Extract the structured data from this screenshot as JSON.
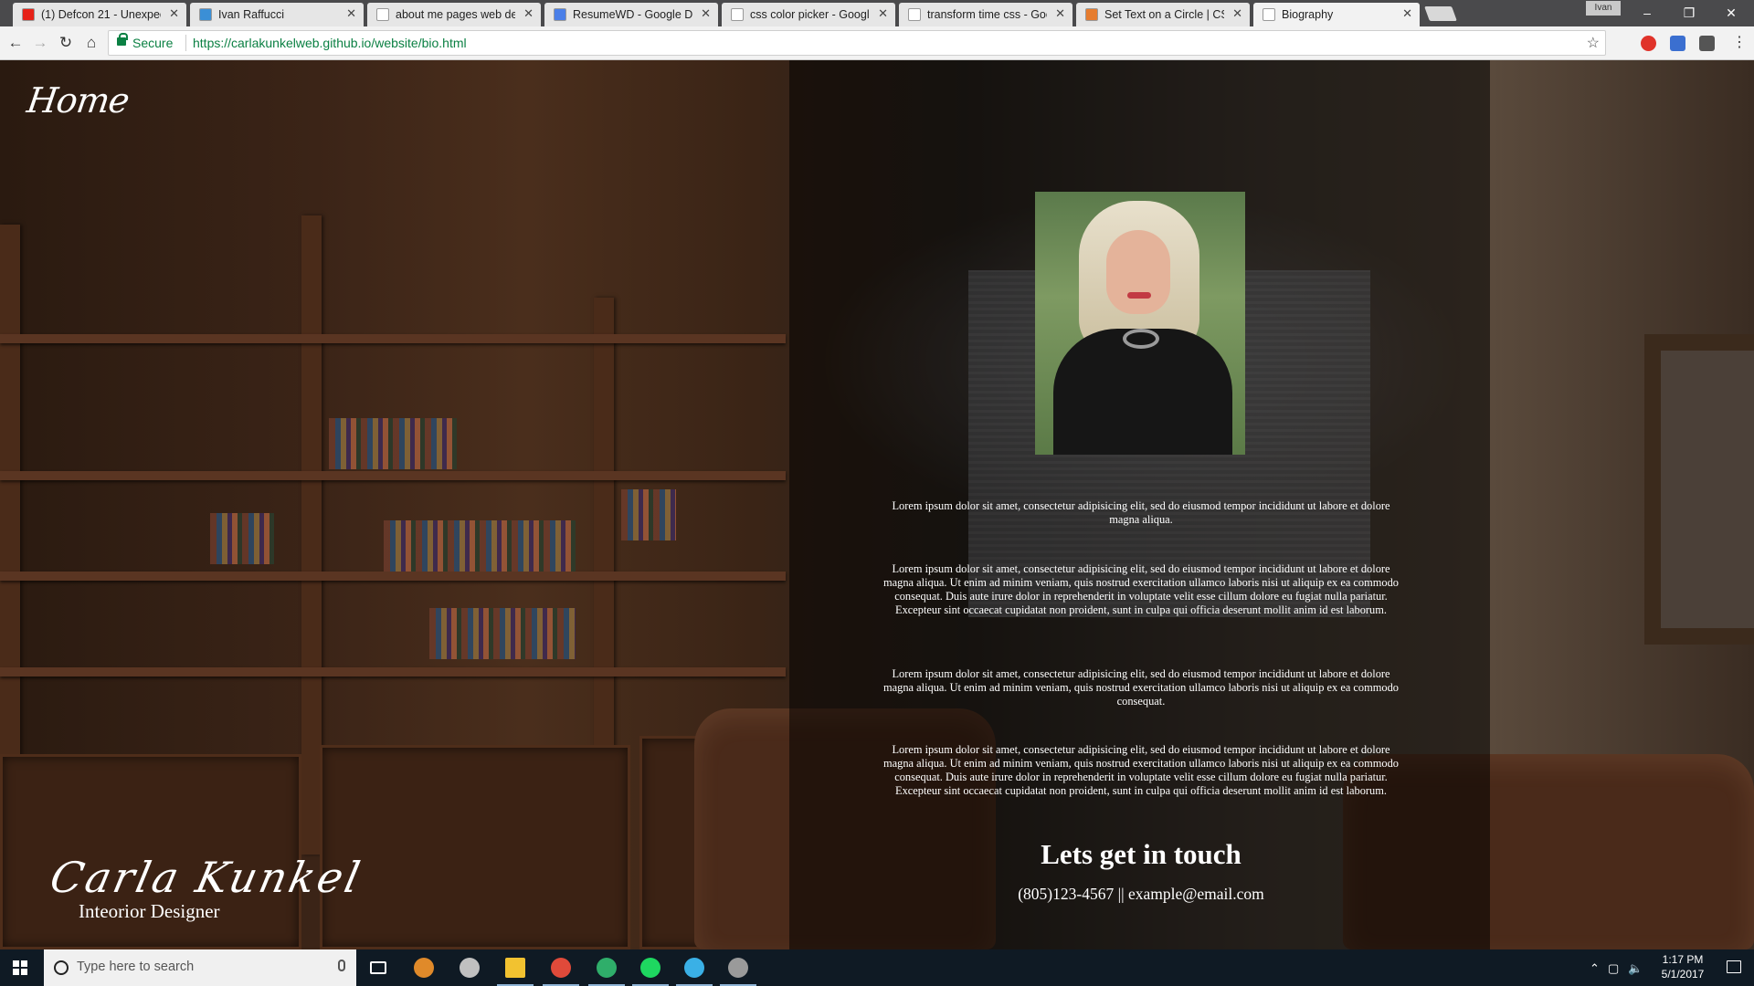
{
  "browser": {
    "tabs": [
      {
        "title": "(1) Defcon 21 - Unexpec",
        "favicon_color": "#e62117",
        "active": false
      },
      {
        "title": "Ivan Raffucci",
        "favicon_color": "#3b8fd6",
        "active": false
      },
      {
        "title": "about me pages web de",
        "favicon_color": "#ffffff",
        "active": false
      },
      {
        "title": "ResumeWD - Google Do",
        "favicon_color": "#4a7fe8",
        "active": false
      },
      {
        "title": "css color picker - Google",
        "favicon_color": "#ffffff",
        "active": false
      },
      {
        "title": "transform time css - Goo",
        "favicon_color": "#ffffff",
        "active": false
      },
      {
        "title": "Set Text on a Circle | CSS",
        "favicon_color": "#e67c2e",
        "active": false
      },
      {
        "title": "Biography",
        "favicon_color": "#ffffff",
        "active": true
      }
    ],
    "profile_name": "Ivan",
    "window_controls": {
      "minimize": "–",
      "maximize": "❐",
      "close": "✕"
    },
    "security_label": "Secure",
    "url": "https://carlakunkelweb.github.io/website/bio.html"
  },
  "page": {
    "home_link": "Home",
    "signature_name": "Carla  Kunkel",
    "signature_title": "Inteorior Designer",
    "portrait_alt": "Portrait photo",
    "paragraphs": [
      "Lorem ipsum dolor sit amet, consectetur adipisicing elit, sed do eiusmod tempor incididunt ut labore et dolore magna aliqua.",
      "Lorem ipsum dolor sit amet, consectetur adipisicing elit, sed do eiusmod tempor incididunt ut labore et dolore magna aliqua. Ut enim ad minim veniam, quis nostrud exercitation ullamco laboris nisi ut aliquip ex ea commodo consequat. Duis aute irure dolor in reprehenderit in voluptate velit esse cillum dolore eu fugiat nulla pariatur. Excepteur sint occaecat cupidatat non proident, sunt in culpa qui officia deserunt mollit anim id est laborum.",
      "Lorem ipsum dolor sit amet, consectetur adipisicing elit, sed do eiusmod tempor incididunt ut labore et dolore magna aliqua. Ut enim ad minim veniam, quis nostrud exercitation ullamco laboris nisi ut aliquip ex ea commodo consequat.",
      "Lorem ipsum dolor sit amet, consectetur adipisicing elit, sed do eiusmod tempor incididunt ut labore et dolore magna aliqua. Ut enim ad minim veniam, quis nostrud exercitation ullamco laboris nisi ut aliquip ex ea commodo consequat. Duis aute irure dolor in reprehenderit in voluptate velit esse cillum dolore eu fugiat nulla pariatur. Excepteur sint occaecat cupidatat non proident, sunt in culpa qui officia deserunt mollit anim id est laborum."
    ],
    "contact_heading": "Lets get in touch",
    "contact_line": "(805)123-4567 || example@email.com"
  },
  "taskbar": {
    "search_placeholder": "Type here to search",
    "apps": [
      {
        "name": "task-view-icon",
        "color": "#ffffff"
      },
      {
        "name": "settings-gear-icon",
        "color": "#e08a2a"
      },
      {
        "name": "app-icon",
        "color": "#c0c0c0"
      },
      {
        "name": "file-explorer-icon",
        "color": "#f2c230"
      },
      {
        "name": "chrome-icon",
        "color": "#e04a3a"
      },
      {
        "name": "tree-app-icon",
        "color": "#2fae6a"
      },
      {
        "name": "spotify-icon",
        "color": "#1ed760"
      },
      {
        "name": "app-icon",
        "color": "#3ab0e6"
      },
      {
        "name": "app-icon",
        "color": "#9a9a9a"
      }
    ],
    "time": "1:17 PM",
    "date": "5/1/2017"
  }
}
